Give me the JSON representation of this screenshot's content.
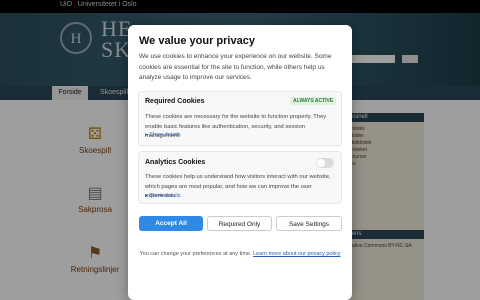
{
  "topbar": {
    "org": "UiO",
    "name": "Universitetet i Oslo"
  },
  "banner": {
    "monogram": "H",
    "title_fragment": "HE SK"
  },
  "nav": {
    "tabs": [
      "Forside",
      "Skoespill"
    ]
  },
  "tiles": [
    {
      "label": "Skoespill",
      "icon": "dice-icon"
    },
    {
      "label": "Sakprosa",
      "icon": "document-icon"
    },
    {
      "label": "Retningslinjer",
      "icon": "signpost-icon"
    }
  ],
  "sidebar": {
    "heading": "Vaksinell",
    "links": [
      "Vitenteks",
      "Nettsider",
      "Nettbibliotek",
      "Biblioteket",
      "Ressurser",
      "Links"
    ],
    "footer_heading": "Lisens",
    "footer_text": "Creative Commons BY-NC-SA"
  },
  "modal": {
    "title": "We value your privacy",
    "intro": "We use cookies to enhance your experience on our website. Some cookies are essential for the site to function, while others help us analyze usage to improve our services.",
    "required": {
      "title": "Required Cookies",
      "badge": "ALWAYS ACTIVE",
      "desc": "These cookies are necessary for the website to function properly. They enable basic features like authentication, security, and session management.",
      "show_details": "Show details"
    },
    "analytics": {
      "title": "Analytics Cookies",
      "desc": "These cookies help us understand how visitors interact with our website, which pages are most popular, and how we can improve the user experience.",
      "show_details": "Show details"
    },
    "buttons": {
      "accept_all": "Accept All",
      "required_only": "Required Only",
      "save_settings": "Save Settings"
    },
    "footer": {
      "text": "You can change your preferences at any time.",
      "link": "Learn more about our privacy policy"
    }
  }
}
